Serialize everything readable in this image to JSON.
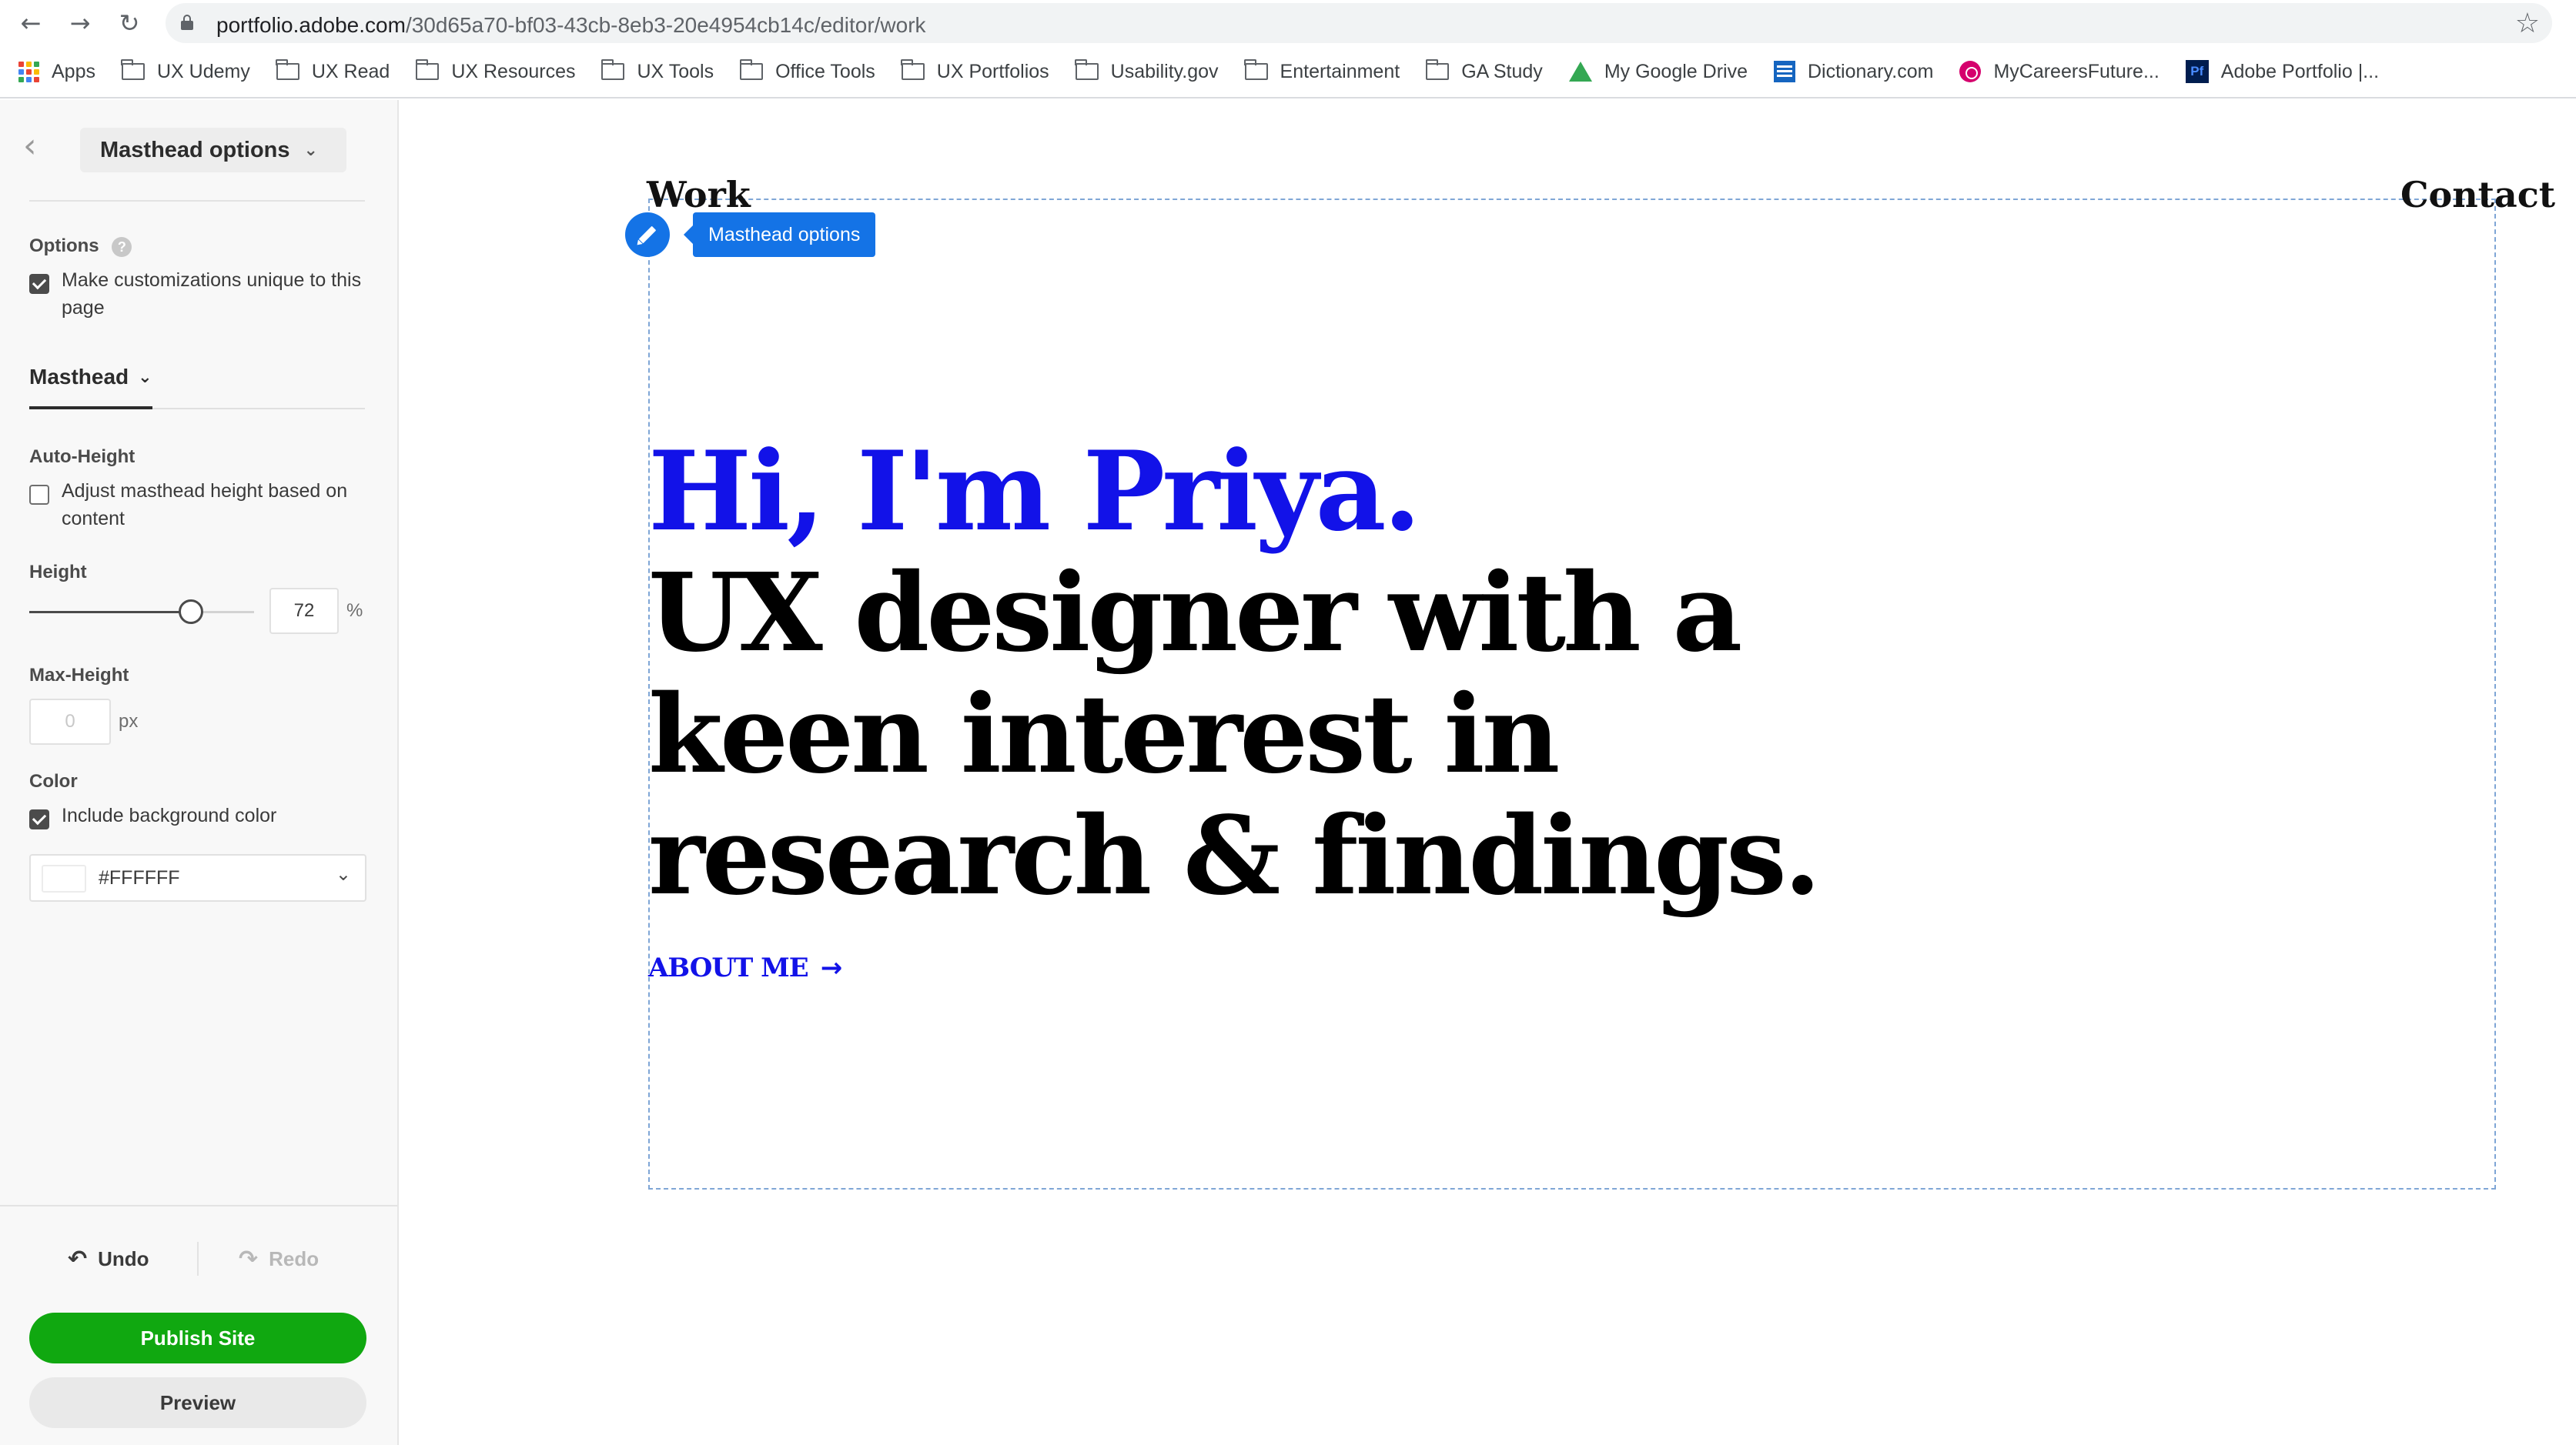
{
  "browser": {
    "url_domain": "portfolio.adobe.com",
    "url_path": "/30d65a70-bf03-43cb-8eb3-20e4954cb14c/editor/work",
    "bookmarks": [
      {
        "label": "Apps",
        "icon": "apps-grid-icon"
      },
      {
        "label": "UX Udemy",
        "icon": "folder-icon"
      },
      {
        "label": "UX Read",
        "icon": "folder-icon"
      },
      {
        "label": "UX Resources",
        "icon": "folder-icon"
      },
      {
        "label": "UX Tools",
        "icon": "folder-icon"
      },
      {
        "label": "Office Tools",
        "icon": "folder-icon"
      },
      {
        "label": "UX Portfolios",
        "icon": "folder-icon"
      },
      {
        "label": "Usability.gov",
        "icon": "folder-icon"
      },
      {
        "label": "Entertainment",
        "icon": "folder-icon"
      },
      {
        "label": "GA Study",
        "icon": "folder-icon"
      },
      {
        "label": "My Google Drive",
        "icon": "google-drive-icon"
      },
      {
        "label": "Dictionary.com",
        "icon": "dictionary-icon"
      },
      {
        "label": "MyCareersFuture...",
        "icon": "mycareersfuture-icon"
      },
      {
        "label": "Adobe Portfolio |...",
        "icon": "adobe-portfolio-icon"
      }
    ]
  },
  "panel": {
    "title": "Masthead options",
    "options_label": "Options",
    "unique_checkbox_label": "Make customizations unique to this page",
    "unique_checked": true,
    "section_tab": "Masthead",
    "auto_height_label": "Auto-Height",
    "auto_height_checkbox_label": "Adjust masthead height based on content",
    "auto_height_checked": false,
    "height_label": "Height",
    "height_value": "72",
    "height_unit": "%",
    "height_slider_fraction": 0.72,
    "max_height_label": "Max-Height",
    "max_height_placeholder": "0",
    "max_height_unit": "px",
    "color_label": "Color",
    "bg_color_checkbox_label": "Include background color",
    "bg_color_checked": true,
    "bg_color_value": "#FFFFFF",
    "undo_label": "Undo",
    "redo_label": "Redo",
    "publish_label": "Publish Site",
    "preview_label": "Preview"
  },
  "canvas": {
    "nav_work": "Work",
    "nav_contact": "Contact",
    "tooltip": "Masthead options",
    "greeting": "Hi, I'm Priya.",
    "tagline": "UX designer with a keen interest in research & findings.",
    "about_link": "ABOUT ME",
    "accent_color": "#1212e8"
  },
  "colors": {
    "publish_green": "#10a810",
    "editor_blue": "#1473e6"
  }
}
